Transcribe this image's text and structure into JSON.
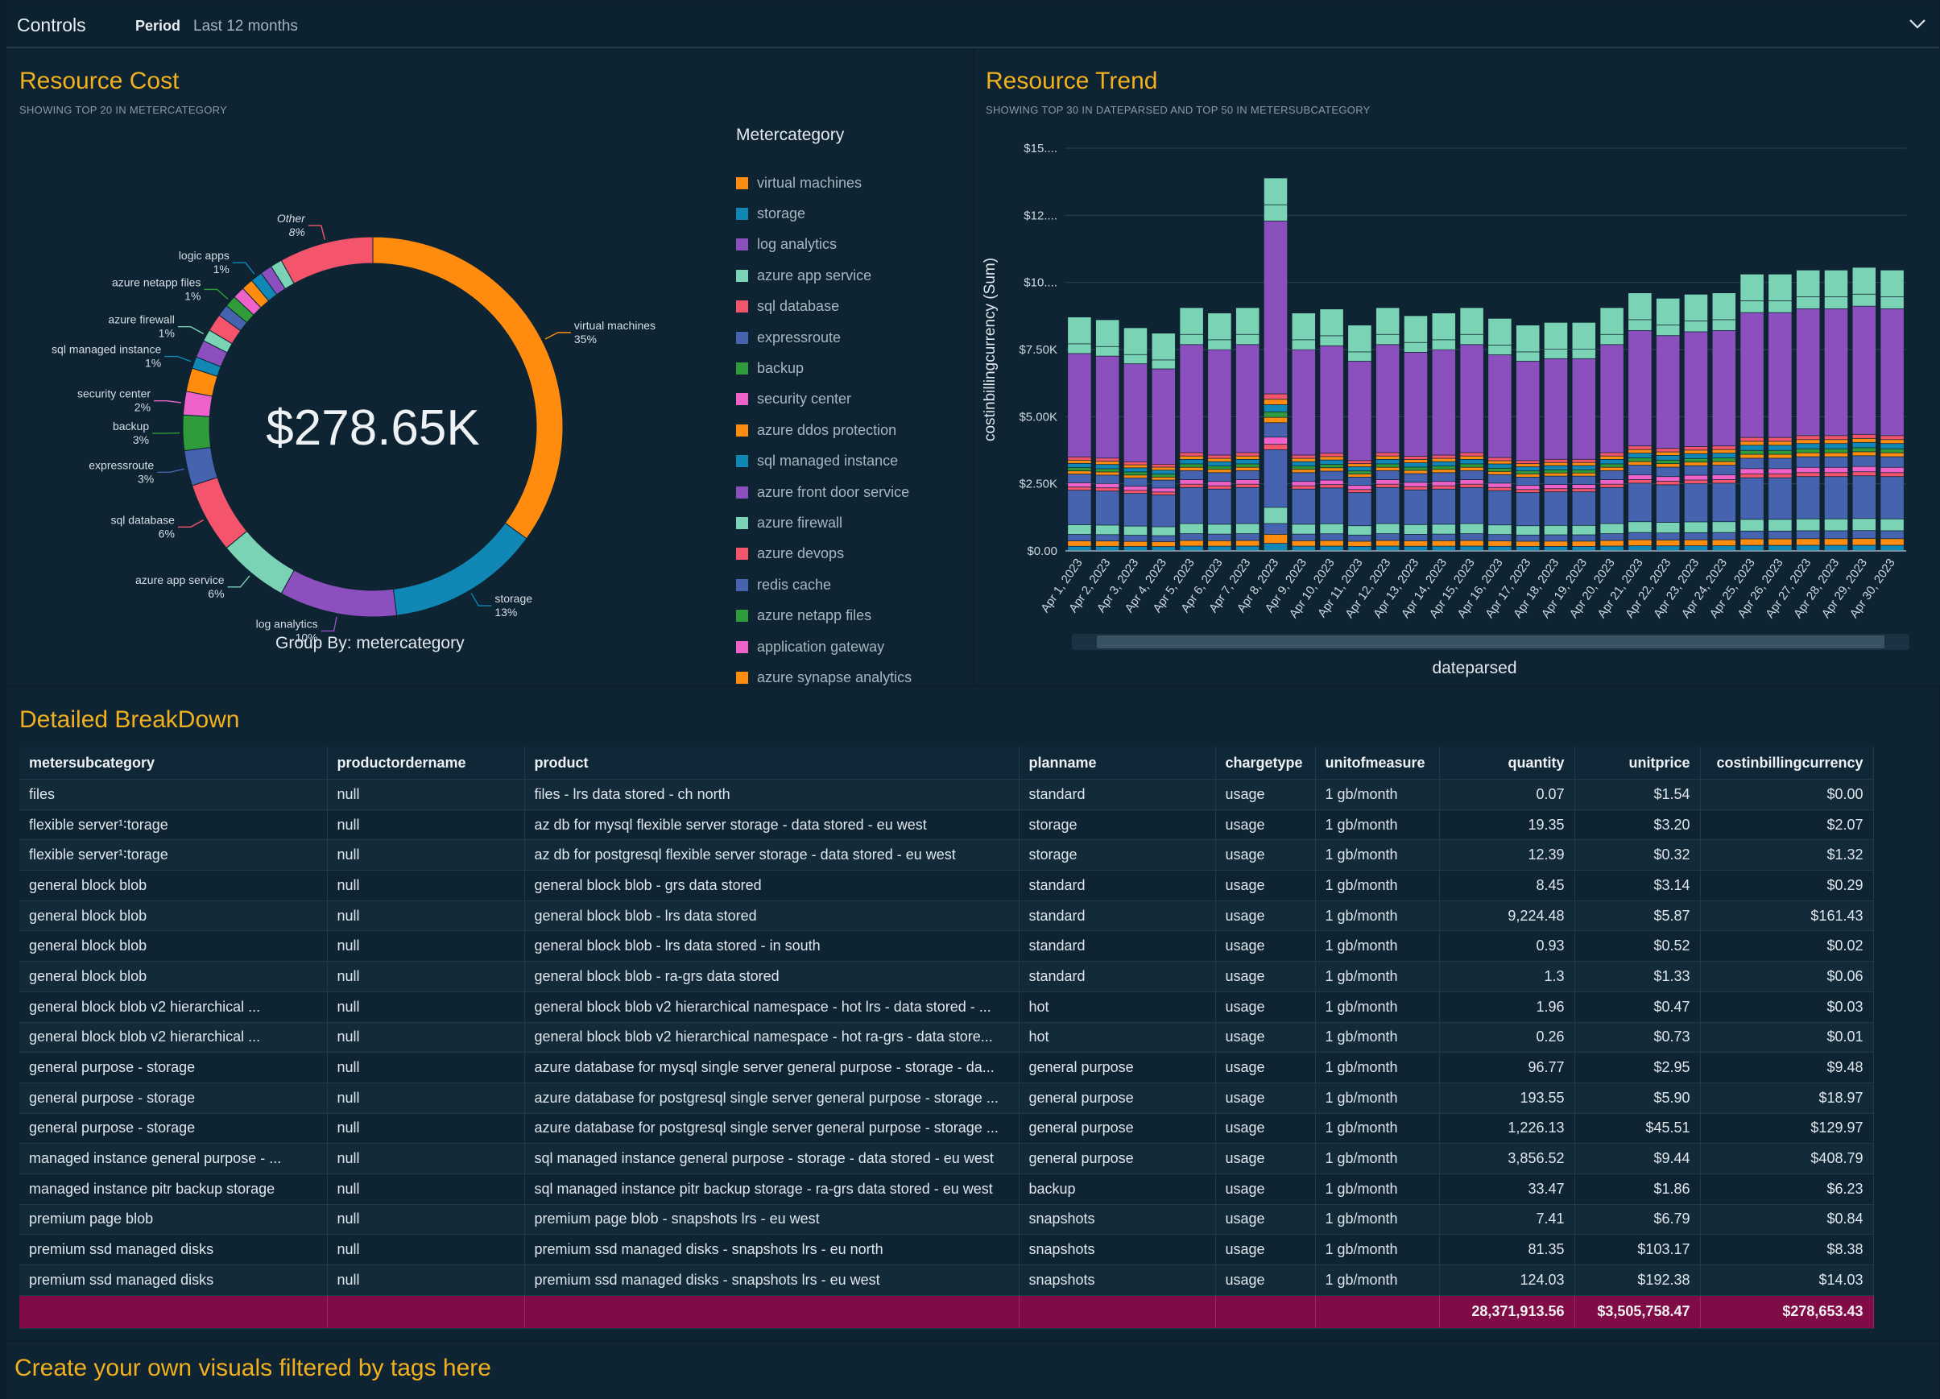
{
  "controls": {
    "title": "Controls",
    "period_label": "Period",
    "period_value": "Last 12 months"
  },
  "resource_cost": {
    "title": "Resource Cost",
    "subtitle": "SHOWING TOP 20 IN METERCATEGORY",
    "total": "$278.65K",
    "group_by": "Group By: metercategory",
    "legend_title": "Metercategory"
  },
  "resource_trend": {
    "title": "Resource Trend",
    "subtitle": "SHOWING TOP 30 IN DATEPARSED AND TOP 50 IN METERSUBCATEGORY",
    "ylabel": "costinbillingcurrency (Sum)",
    "xlabel": "dateparsed"
  },
  "breakdown": {
    "title": "Detailed BreakDown",
    "columns": [
      "metersubcategory",
      "productordername",
      "product",
      "planname",
      "chargetype",
      "unitofmeasure",
      "quantity",
      "unitprice",
      "costinbillingcurrency"
    ],
    "rows": [
      [
        "files",
        "null",
        "files - lrs data stored - ch north",
        "standard",
        "usage",
        "1 gb/month",
        "0.07",
        "$1.54",
        "$0.00"
      ],
      [
        "flexible server¹∶torage",
        "null",
        "az db for mysql flexible server storage - data stored - eu west",
        "storage",
        "usage",
        "1 gb/month",
        "19.35",
        "$3.20",
        "$2.07"
      ],
      [
        "flexible server¹∶torage",
        "null",
        "az db for postgresql flexible server storage - data stored - eu west",
        "storage",
        "usage",
        "1 gb/month",
        "12.39",
        "$0.32",
        "$1.32"
      ],
      [
        "general block blob",
        "null",
        "general block blob - grs data stored",
        "standard",
        "usage",
        "1 gb/month",
        "8.45",
        "$3.14",
        "$0.29"
      ],
      [
        "general block blob",
        "null",
        "general block blob - lrs data stored",
        "standard",
        "usage",
        "1 gb/month",
        "9,224.48",
        "$5.87",
        "$161.43"
      ],
      [
        "general block blob",
        "null",
        "general block blob - lrs data stored - in south",
        "standard",
        "usage",
        "1 gb/month",
        "0.93",
        "$0.52",
        "$0.02"
      ],
      [
        "general block blob",
        "null",
        "general block blob - ra-grs data stored",
        "standard",
        "usage",
        "1 gb/month",
        "1.3",
        "$1.33",
        "$0.06"
      ],
      [
        "general block blob v2 hierarchical ...",
        "null",
        "general block blob v2 hierarchical namespace - hot lrs - data stored - ...",
        "hot",
        "usage",
        "1 gb/month",
        "1.96",
        "$0.47",
        "$0.03"
      ],
      [
        "general block blob v2 hierarchical ...",
        "null",
        "general block blob v2 hierarchical namespace - hot ra-grs - data store...",
        "hot",
        "usage",
        "1 gb/month",
        "0.26",
        "$0.73",
        "$0.01"
      ],
      [
        "general purpose - storage",
        "null",
        "azure database for mysql single server general purpose - storage - da...",
        "general purpose",
        "usage",
        "1 gb/month",
        "96.77",
        "$2.95",
        "$9.48"
      ],
      [
        "general purpose - storage",
        "null",
        "azure database for postgresql single server general purpose - storage ...",
        "general purpose",
        "usage",
        "1 gb/month",
        "193.55",
        "$5.90",
        "$18.97"
      ],
      [
        "general purpose - storage",
        "null",
        "azure database for postgresql single server general purpose - storage ...",
        "general purpose",
        "usage",
        "1 gb/month",
        "1,226.13",
        "$45.51",
        "$129.97"
      ],
      [
        "managed instance general purpose - ...",
        "null",
        "sql managed instance general purpose - storage - data stored - eu west",
        "general purpose",
        "usage",
        "1 gb/month",
        "3,856.52",
        "$9.44",
        "$408.79"
      ],
      [
        "managed instance pitr backup storage",
        "null",
        "sql managed instance pitr backup storage - ra-grs data stored - eu west",
        "backup",
        "usage",
        "1 gb/month",
        "33.47",
        "$1.86",
        "$6.23"
      ],
      [
        "premium page blob",
        "null",
        "premium page blob - snapshots lrs - eu west",
        "snapshots",
        "usage",
        "1 gb/month",
        "7.41",
        "$6.79",
        "$0.84"
      ],
      [
        "premium ssd managed disks",
        "null",
        "premium ssd managed disks - snapshots lrs - eu north",
        "snapshots",
        "usage",
        "1 gb/month",
        "81.35",
        "$103.17",
        "$8.38"
      ],
      [
        "premium ssd managed disks",
        "null",
        "premium ssd managed disks - snapshots lrs - eu west",
        "snapshots",
        "usage",
        "1 gb/month",
        "124.03",
        "$192.38",
        "$14.03"
      ]
    ],
    "totals": [
      "",
      "",
      "",
      "",
      "",
      "",
      "28,371,913.56",
      "$3,505,758.47",
      "$278,653.43"
    ]
  },
  "footer": {
    "title": "Create your own visuals filtered by tags here"
  },
  "chart_data": [
    {
      "type": "pie",
      "title": "Resource Cost",
      "center_label": "$278.65K",
      "slices": [
        {
          "label": "virtual machines",
          "percent": 35,
          "color": "#ff8c0e"
        },
        {
          "label": "storage",
          "percent": 13,
          "color": "#1087b4"
        },
        {
          "label": "log analytics",
          "percent": 10,
          "color": "#8c4fbe"
        },
        {
          "label": "azure app service",
          "percent": 6,
          "color": "#7ad3b4"
        },
        {
          "label": "sql database",
          "percent": 6,
          "color": "#f4546c"
        },
        {
          "label": "expressroute",
          "percent": 3,
          "color": "#4563ae"
        },
        {
          "label": "backup",
          "percent": 3,
          "color": "#2f9b3b"
        },
        {
          "label": "security center",
          "percent": 2,
          "color": "#ef62c9"
        },
        {
          "label": "azure ddos protection",
          "percent": 2,
          "color": "#ff8c0e"
        },
        {
          "label": "sql managed instance",
          "percent": 1,
          "color": "#1087b4"
        },
        {
          "label": "azure front door service",
          "percent": 1.5,
          "color": "#8c4fbe"
        },
        {
          "label": "azure firewall",
          "percent": 1,
          "color": "#7ad3b4"
        },
        {
          "label": "azure devops",
          "percent": 1.5,
          "color": "#f4546c"
        },
        {
          "label": "redis cache",
          "percent": 1,
          "color": "#4563ae"
        },
        {
          "label": "azure netapp files",
          "percent": 1,
          "color": "#2f9b3b"
        },
        {
          "label": "application gateway",
          "percent": 1,
          "color": "#ef62c9"
        },
        {
          "label": "azure synapse analytics",
          "percent": 1,
          "color": "#ff8c0e"
        },
        {
          "label": "logic apps",
          "percent": 1,
          "color": "#1087b4"
        },
        {
          "label": "",
          "percent": 1,
          "color": "#8c4fbe"
        },
        {
          "label": "",
          "percent": 1,
          "color": "#7ad3b4"
        },
        {
          "label": "Other",
          "percent": 8,
          "color": "#f4546c"
        }
      ],
      "callouts": [
        {
          "label": "virtual machines",
          "pct": "35%"
        },
        {
          "label": "storage",
          "pct": "13%"
        },
        {
          "label": "log analytics",
          "pct": "10%"
        },
        {
          "label": "azure app service",
          "pct": "6%"
        },
        {
          "label": "sql database",
          "pct": "6%"
        },
        {
          "label": "expressroute",
          "pct": "3%"
        },
        {
          "label": "backup",
          "pct": "3%"
        },
        {
          "label": "security center",
          "pct": "2%"
        },
        {
          "label": "sql managed instance",
          "pct": "1%"
        },
        {
          "label": "azure firewall",
          "pct": "1%"
        },
        {
          "label": "azure netapp files",
          "pct": "1%"
        },
        {
          "label": "logic apps",
          "pct": "1%"
        },
        {
          "label": "Other",
          "pct": "8%"
        }
      ],
      "legend": [
        "virtual machines",
        "storage",
        "log analytics",
        "azure app service",
        "sql database",
        "expressroute",
        "backup",
        "security center",
        "azure ddos protection",
        "sql managed instance",
        "azure front door service",
        "azure firewall",
        "azure devops",
        "redis cache",
        "azure netapp files",
        "application gateway",
        "azure synapse analytics"
      ],
      "legend_colors": [
        "#ff8c0e",
        "#1087b4",
        "#8c4fbe",
        "#7ad3b4",
        "#f4546c",
        "#4563ae",
        "#2f9b3b",
        "#ef62c9",
        "#ff8c0e",
        "#1087b4",
        "#8c4fbe",
        "#7ad3b4",
        "#f4546c",
        "#4563ae",
        "#2f9b3b",
        "#ef62c9",
        "#ff8c0e"
      ]
    },
    {
      "type": "bar",
      "stacked": true,
      "title": "Resource Trend",
      "xlabel": "dateparsed",
      "ylabel": "costinbillingcurrency (Sum)",
      "y_ticks": [
        "$0.00",
        "$2.50K",
        "$5.00K",
        "$7.50K",
        "$10....",
        "$12....",
        "$15...."
      ],
      "ylim": [
        0,
        15000
      ],
      "categories": [
        "Apr 1, 2023",
        "Apr 2, 2023",
        "Apr 3, 2023",
        "Apr 4, 2023",
        "Apr 5, 2023",
        "Apr 6, 2023",
        "Apr 7, 2023",
        "Apr 8, 2023",
        "Apr 9, 2023",
        "Apr 10, 2023",
        "Apr 11, 2023",
        "Apr 12, 2023",
        "Apr 13, 2023",
        "Apr 14, 2023",
        "Apr 15, 2023",
        "Apr 16, 2023",
        "Apr 17, 2023",
        "Apr 18, 2023",
        "Apr 19, 2023",
        "Apr 20, 2023",
        "Apr 21, 2023",
        "Apr 22, 2023",
        "Apr 23, 2023",
        "Apr 24, 2023",
        "Apr 25, 2023",
        "Apr 26, 2023",
        "Apr 27, 2023",
        "Apr 28, 2023",
        "Apr 29, 2023",
        "Apr 30, 2023"
      ],
      "totals": [
        8700,
        8600,
        8300,
        8100,
        9050,
        8850,
        9050,
        13880,
        8850,
        9000,
        8400,
        9050,
        8750,
        8850,
        9050,
        8650,
        8400,
        8500,
        8500,
        9050,
        9600,
        9400,
        9550,
        9600,
        10300,
        10300,
        10450,
        10450,
        10550,
        10450
      ],
      "segment_colors": [
        "#1087b4",
        "#ff8c0e",
        "#4563ae",
        "#7ad3b4",
        "#4563ae",
        "#f4546c",
        "#ef62c9",
        "#4563ae",
        "#ff8c0e",
        "#2f9b3b",
        "#1087b4",
        "#ff8c0e",
        "#f4546c",
        "#8c4fbe",
        "#7ad3b4"
      ],
      "segment_shares": [
        0.02,
        0.025,
        0.03,
        0.045,
        0.16,
        0.015,
        0.02,
        0.04,
        0.015,
        0.015,
        0.02,
        0.015,
        0.015,
        0.48,
        0.045
      ]
    }
  ]
}
